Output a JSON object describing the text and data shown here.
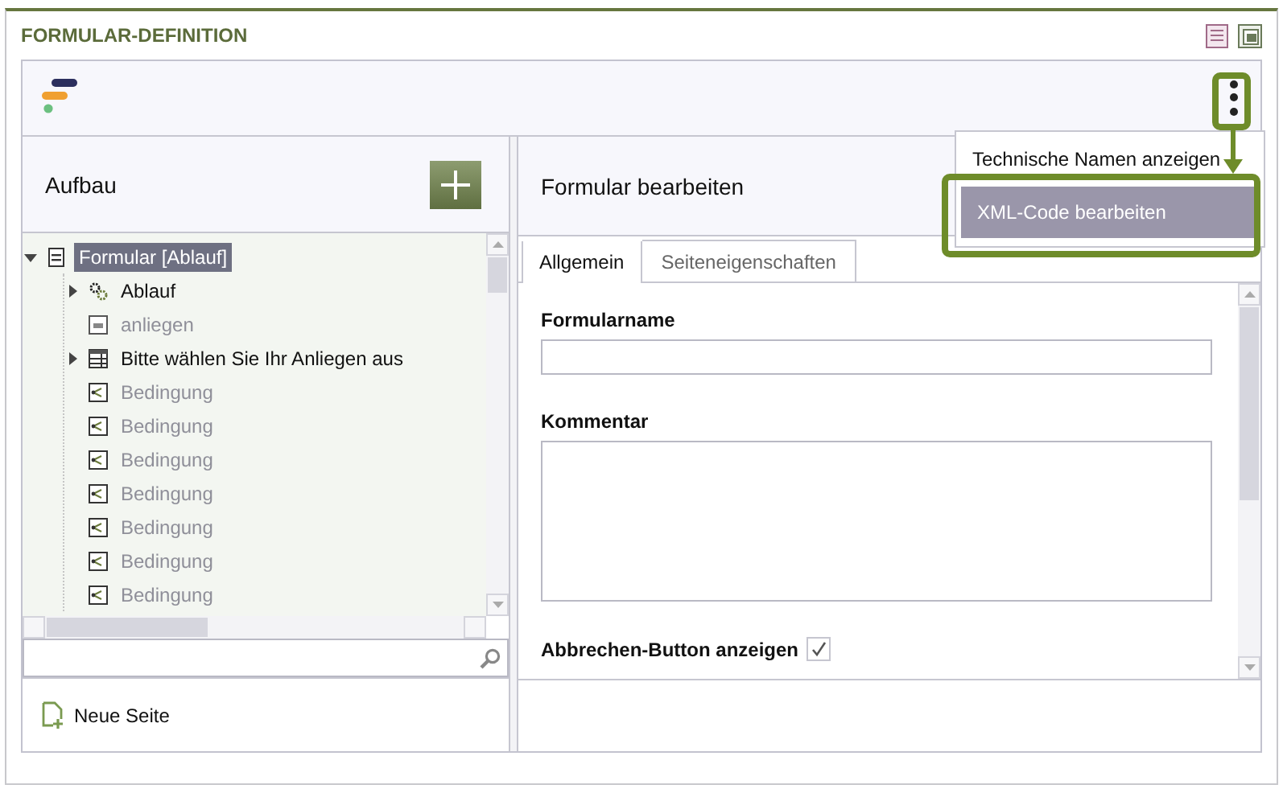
{
  "panel": {
    "title": "FORMULAR-DEFINITION"
  },
  "menu": {
    "items": [
      {
        "label": "Technische Namen anzeigen",
        "selected": false
      },
      {
        "label": "XML-Code bearbeiten",
        "selected": true
      }
    ]
  },
  "structure": {
    "title": "Aufbau",
    "tree": [
      {
        "label": "Formular [Ablauf]",
        "kind": "form",
        "selected": true,
        "disabled": false,
        "expanded": true,
        "children": [
          {
            "label": "Ablauf",
            "kind": "gears",
            "selected": false,
            "disabled": false,
            "expanded": false
          },
          {
            "label": "anliegen",
            "kind": "text-field",
            "selected": false,
            "disabled": true
          },
          {
            "label": "Bitte wählen Sie Ihr Anliegen aus",
            "kind": "table",
            "selected": false,
            "disabled": false,
            "expanded": false
          },
          {
            "label": "Bedingung",
            "kind": "condition",
            "selected": false,
            "disabled": true
          },
          {
            "label": "Bedingung",
            "kind": "condition",
            "selected": false,
            "disabled": true
          },
          {
            "label": "Bedingung",
            "kind": "condition",
            "selected": false,
            "disabled": true
          },
          {
            "label": "Bedingung",
            "kind": "condition",
            "selected": false,
            "disabled": true
          },
          {
            "label": "Bedingung",
            "kind": "condition",
            "selected": false,
            "disabled": true
          },
          {
            "label": "Bedingung",
            "kind": "condition",
            "selected": false,
            "disabled": true
          },
          {
            "label": "Bedingung",
            "kind": "condition",
            "selected": false,
            "disabled": true
          }
        ]
      }
    ],
    "new_page": "Neue Seite"
  },
  "editor": {
    "title": "Formular bearbeiten",
    "tabs": [
      {
        "label": "Allgemein",
        "selected": true
      },
      {
        "label": "Seiteneigenschaften",
        "selected": false
      }
    ],
    "fields": [
      {
        "kind": "text",
        "label": "Formularname"
      },
      {
        "kind": "textarea",
        "label": "Kommentar"
      },
      {
        "kind": "checkbox",
        "label": "Abbrechen-Button anzeigen",
        "checked": true
      }
    ]
  }
}
